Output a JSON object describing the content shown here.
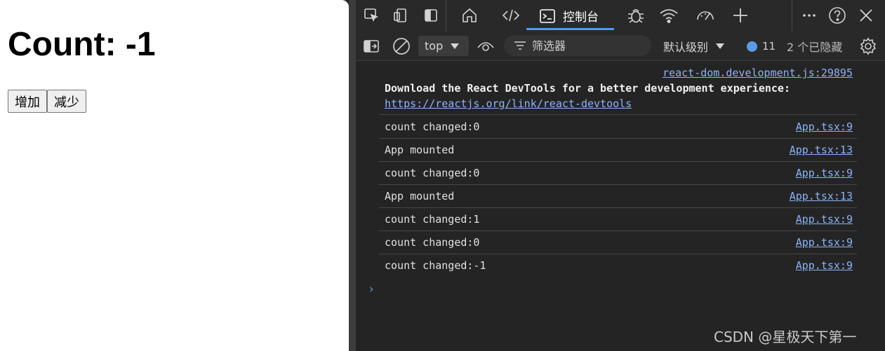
{
  "app": {
    "count_label": "Count: -1",
    "increment_button": "增加",
    "decrement_button": "减少"
  },
  "devtools": {
    "tabs": {
      "icons": [
        "inspect-icon",
        "device-emulation-icon",
        "dock-icon",
        "welcome-home-icon",
        "elements-icon",
        "console-icon",
        "sources-bug-icon",
        "network-icon",
        "performance-icon",
        "add-tab-icon",
        "more-icon",
        "help-icon",
        "close-icon"
      ],
      "active_label": "控制台"
    },
    "toolbar": {
      "context": "top",
      "filter_placeholder": "筛选器",
      "levels": "默认级别",
      "issues_count": "11",
      "hidden": "2 个已隐藏"
    },
    "console": {
      "first_message": {
        "source": "react-dom.development.js:29895",
        "text": "Download the React DevTools for a better development experience:",
        "link": "https://reactjs.org/link/react-devtools"
      },
      "messages": [
        {
          "text": "count changed:0",
          "source": "App.tsx:9"
        },
        {
          "text": "App mounted",
          "source": "App.tsx:13"
        },
        {
          "text": "count changed:0",
          "source": "App.tsx:9"
        },
        {
          "text": "App mounted",
          "source": "App.tsx:13"
        },
        {
          "text": "count changed:1",
          "source": "App.tsx:9"
        },
        {
          "text": "count changed:0",
          "source": "App.tsx:9"
        },
        {
          "text": "count changed:-1",
          "source": "App.tsx:9"
        }
      ],
      "prompt": "›"
    }
  },
  "watermark": "CSDN @星极天下第一"
}
